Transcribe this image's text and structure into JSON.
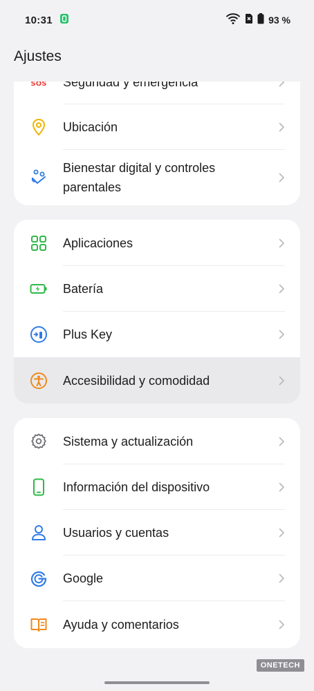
{
  "status_bar": {
    "time": "10:31",
    "battery": "93 %",
    "icons": [
      "notification-app-icon",
      "wifi-icon",
      "no-sim-icon",
      "battery-icon"
    ]
  },
  "header": {
    "title": "Ajustes"
  },
  "groups": [
    {
      "items": [
        {
          "id": "seguridad",
          "label": "Seguridad y emergencia",
          "icon": "sos-icon",
          "color": "#e8443a"
        },
        {
          "id": "ubicacion",
          "label": "Ubicación",
          "icon": "location-pin-icon",
          "color": "#f0b400"
        },
        {
          "id": "bienestar",
          "label": "Bienestar digital y controles parentales",
          "icon": "wellbeing-icon",
          "color": "#2f7be6"
        }
      ]
    },
    {
      "items": [
        {
          "id": "aplicaciones",
          "label": "Aplicaciones",
          "icon": "apps-grid-icon",
          "color": "#2fb84a"
        },
        {
          "id": "bateria",
          "label": "Batería",
          "icon": "battery-charging-icon",
          "color": "#2fb84a"
        },
        {
          "id": "pluskey",
          "label": "Plus Key",
          "icon": "plus-key-icon",
          "color": "#2f7be6"
        },
        {
          "id": "accesibilidad",
          "label": "Accesibilidad y comodidad",
          "icon": "accessibility-icon",
          "color": "#f08a1c",
          "highlighted": true
        }
      ]
    },
    {
      "items": [
        {
          "id": "sistema",
          "label": "Sistema y actualización",
          "icon": "gear-icon",
          "color": "#6e6e73"
        },
        {
          "id": "info",
          "label": "Información del dispositivo",
          "icon": "phone-device-icon",
          "color": "#2fb84a"
        },
        {
          "id": "usuarios",
          "label": "Usuarios y cuentas",
          "icon": "user-icon",
          "color": "#2f7be6"
        },
        {
          "id": "google",
          "label": "Google",
          "icon": "google-icon",
          "color": "#2f7be6"
        },
        {
          "id": "ayuda",
          "label": "Ayuda y comentarios",
          "icon": "help-book-icon",
          "color": "#f08a1c"
        }
      ]
    }
  ],
  "watermark": "ONETECH"
}
